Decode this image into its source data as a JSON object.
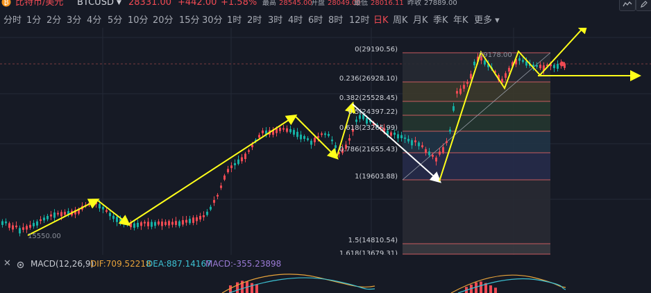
{
  "header": {
    "symbol_name": "比特币/美元",
    "symbol_code": "BTCUSD",
    "price": "28331.00",
    "change": "+442.00",
    "change_pct": "+1.58%",
    "high_label": "最高",
    "high_value": "28545.00",
    "open_label": "开盘",
    "open_value": "28049.00",
    "low_label": "最低",
    "low_value": "28016.11",
    "prev_close_label": "昨收",
    "prev_close_value": "27889.00"
  },
  "timeframes": [
    "分时",
    "1分",
    "2分",
    "3分",
    "4分",
    "5分",
    "10分",
    "20分",
    "15分",
    "30分",
    "1时",
    "2时",
    "3时",
    "4时",
    "6时",
    "8时",
    "12时",
    "日K",
    "周K",
    "月K",
    "季K",
    "年K"
  ],
  "active_timeframe": "日K",
  "more_label": "更多",
  "chart_labels": {
    "low_marker": "15550.00",
    "high_marker": "29178.00"
  },
  "fib_levels": [
    {
      "label": "0(29190.56)"
    },
    {
      "label": "0.236(26928.10)"
    },
    {
      "label": "0.382(25528.45)"
    },
    {
      "label": "0.5(24397.22)"
    },
    {
      "label": "0.618(23265.99)"
    },
    {
      "label": "0.786(21655.43)"
    },
    {
      "label": "1(19603.88)"
    },
    {
      "label": "1.5(14810.54)"
    },
    {
      "label": "1.618(13679.31)"
    }
  ],
  "macd": {
    "name": "MACD(12,26,9)",
    "dif": "DIF:709.52218",
    "dea": "DEA:887.14167",
    "macd": "MACD:-355.23898"
  },
  "colors": {
    "up": "#ef4a53",
    "down": "#14b1a5",
    "arrow_yellow": "#ffff1a",
    "arrow_white": "#ffffff",
    "dif_line": "#e8a33a",
    "dea_line": "#3dc1d3",
    "macd_label": "#9b7bd6"
  }
}
